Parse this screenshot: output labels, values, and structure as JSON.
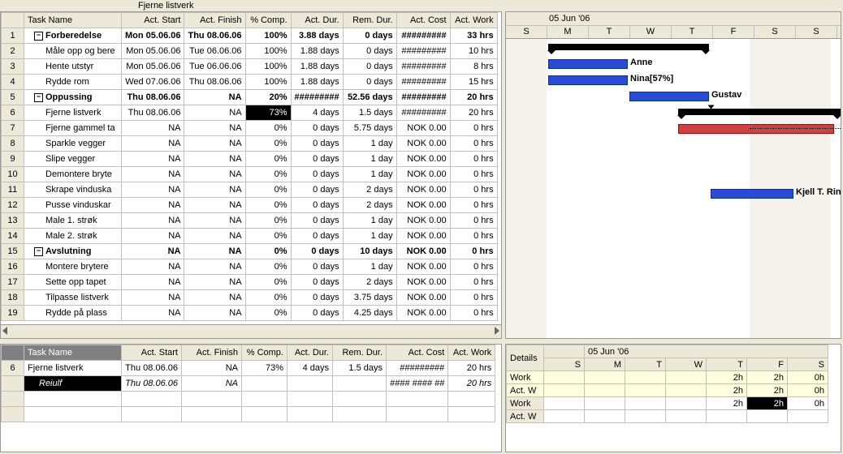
{
  "breadcrumb": "Fjerne listverk",
  "columns": [
    "Task Name",
    "Act. Start",
    "Act. Finish",
    "% Comp.",
    "Act. Dur.",
    "Rem. Dur.",
    "Act. Cost",
    "Act. Work"
  ],
  "rows": [
    {
      "n": 1,
      "lvl": 0,
      "out": "-",
      "name": "Forberedelse",
      "start": "Mon 05.06.06",
      "finish": "Thu 08.06.06",
      "comp": "100%",
      "dur": "3.88 days",
      "rem": "0 days",
      "cost": "#########",
      "work": "33 hrs",
      "bold": true
    },
    {
      "n": 2,
      "lvl": 1,
      "name": "Måle opp og bere",
      "start": "Mon 05.06.06",
      "finish": "Tue 06.06.06",
      "comp": "100%",
      "dur": "1.88 days",
      "rem": "0 days",
      "cost": "#########",
      "work": "10 hrs"
    },
    {
      "n": 3,
      "lvl": 1,
      "name": "Hente utstyr",
      "start": "Mon 05.06.06",
      "finish": "Tue 06.06.06",
      "comp": "100%",
      "dur": "1.88 days",
      "rem": "0 days",
      "cost": "#########",
      "work": "8 hrs"
    },
    {
      "n": 4,
      "lvl": 1,
      "name": "Rydde rom",
      "start": "Wed 07.06.06",
      "finish": "Thu 08.06.06",
      "comp": "100%",
      "dur": "1.88 days",
      "rem": "0 days",
      "cost": "#########",
      "work": "15 hrs"
    },
    {
      "n": 5,
      "lvl": 0,
      "out": "-",
      "name": "Oppussing",
      "start": "Thu 08.06.06",
      "finish": "NA",
      "comp": "20%",
      "dur": "#########",
      "rem": "52.56 days",
      "cost": "#########",
      "work": "20 hrs",
      "bold": true
    },
    {
      "n": 6,
      "lvl": 1,
      "name": "Fjerne listverk",
      "start": "Thu 08.06.06",
      "finish": "NA",
      "comp": "73%",
      "dur": "4 days",
      "rem": "1.5 days",
      "cost": "#########",
      "work": "20 hrs",
      "selcomp": true
    },
    {
      "n": 7,
      "lvl": 1,
      "name": "Fjerne gammel ta",
      "start": "NA",
      "finish": "NA",
      "comp": "0%",
      "dur": "0 days",
      "rem": "5.75 days",
      "cost": "NOK 0.00",
      "work": "0 hrs"
    },
    {
      "n": 8,
      "lvl": 1,
      "name": "Sparkle vegger",
      "start": "NA",
      "finish": "NA",
      "comp": "0%",
      "dur": "0 days",
      "rem": "1 day",
      "cost": "NOK 0.00",
      "work": "0 hrs"
    },
    {
      "n": 9,
      "lvl": 1,
      "name": "Slipe vegger",
      "start": "NA",
      "finish": "NA",
      "comp": "0%",
      "dur": "0 days",
      "rem": "1 day",
      "cost": "NOK 0.00",
      "work": "0 hrs"
    },
    {
      "n": 10,
      "lvl": 1,
      "name": "Demontere bryte",
      "start": "NA",
      "finish": "NA",
      "comp": "0%",
      "dur": "0 days",
      "rem": "1 day",
      "cost": "NOK 0.00",
      "work": "0 hrs"
    },
    {
      "n": 11,
      "lvl": 1,
      "name": "Skrape vinduska",
      "start": "NA",
      "finish": "NA",
      "comp": "0%",
      "dur": "0 days",
      "rem": "2 days",
      "cost": "NOK 0.00",
      "work": "0 hrs"
    },
    {
      "n": 12,
      "lvl": 1,
      "name": "Pusse vinduskar",
      "start": "NA",
      "finish": "NA",
      "comp": "0%",
      "dur": "0 days",
      "rem": "2 days",
      "cost": "NOK 0.00",
      "work": "0 hrs"
    },
    {
      "n": 13,
      "lvl": 1,
      "name": "Male 1. strøk",
      "start": "NA",
      "finish": "NA",
      "comp": "0%",
      "dur": "0 days",
      "rem": "1 day",
      "cost": "NOK 0.00",
      "work": "0 hrs"
    },
    {
      "n": 14,
      "lvl": 1,
      "name": "Male 2. strøk",
      "start": "NA",
      "finish": "NA",
      "comp": "0%",
      "dur": "0 days",
      "rem": "1 day",
      "cost": "NOK 0.00",
      "work": "0 hrs"
    },
    {
      "n": 15,
      "lvl": 0,
      "out": "-",
      "name": "Avslutning",
      "start": "NA",
      "finish": "NA",
      "comp": "0%",
      "dur": "0 days",
      "rem": "10 days",
      "cost": "NOK 0.00",
      "work": "0 hrs",
      "bold": true
    },
    {
      "n": 16,
      "lvl": 1,
      "name": "Montere brytere",
      "start": "NA",
      "finish": "NA",
      "comp": "0%",
      "dur": "0 days",
      "rem": "1 day",
      "cost": "NOK 0.00",
      "work": "0 hrs"
    },
    {
      "n": 17,
      "lvl": 1,
      "name": "Sette opp tapet",
      "start": "NA",
      "finish": "NA",
      "comp": "0%",
      "dur": "0 days",
      "rem": "2 days",
      "cost": "NOK 0.00",
      "work": "0 hrs"
    },
    {
      "n": 18,
      "lvl": 1,
      "name": "Tilpasse listverk",
      "start": "NA",
      "finish": "NA",
      "comp": "0%",
      "dur": "0 days",
      "rem": "3.75 days",
      "cost": "NOK 0.00",
      "work": "0 hrs"
    },
    {
      "n": 19,
      "lvl": 1,
      "name": "Rydde på plass",
      "start": "NA",
      "finish": "NA",
      "comp": "0%",
      "dur": "0 days",
      "rem": "4.25 days",
      "cost": "NOK 0.00",
      "work": "0 hrs"
    }
  ],
  "gantt": {
    "week_label": "05 Jun '06",
    "days": [
      "S",
      "M",
      "T",
      "W",
      "T",
      "F",
      "S",
      "S"
    ]
  },
  "detailPane": {
    "rownum": "6",
    "task": {
      "name": "Fjerne listverk",
      "start": "Thu 08.06.06",
      "finish": "NA",
      "comp": "73%",
      "dur": "4 days",
      "rem": "1.5 days",
      "cost": "#########",
      "work": "20 hrs"
    },
    "resource": {
      "name": "Reiulf",
      "start": "Thu 08.06.06",
      "finish": "NA",
      "comp": "",
      "dur": "",
      "rem": "",
      "cost": "#### #### ##",
      "work": "20 hrs"
    }
  },
  "usage": {
    "label": "Details",
    "week_label": "05 Jun '06",
    "days": [
      "S",
      "M",
      "T",
      "W",
      "T",
      "F",
      "S"
    ],
    "rows": [
      {
        "label": "Work",
        "cls": "yl",
        "vals": [
          "",
          "",
          "",
          "",
          "2h",
          "2h",
          "0h"
        ]
      },
      {
        "label": "Act. W",
        "cls": "yl",
        "vals": [
          "",
          "",
          "",
          "",
          "2h",
          "2h",
          "0h"
        ]
      },
      {
        "label": "Work",
        "cls": "",
        "vals": [
          "",
          "",
          "",
          "",
          "2h",
          "2h",
          "0h"
        ],
        "sel": 5
      },
      {
        "label": "Act. W",
        "cls": "",
        "vals": [
          "",
          "",
          "",
          "",
          "",
          "",
          ""
        ]
      }
    ]
  }
}
